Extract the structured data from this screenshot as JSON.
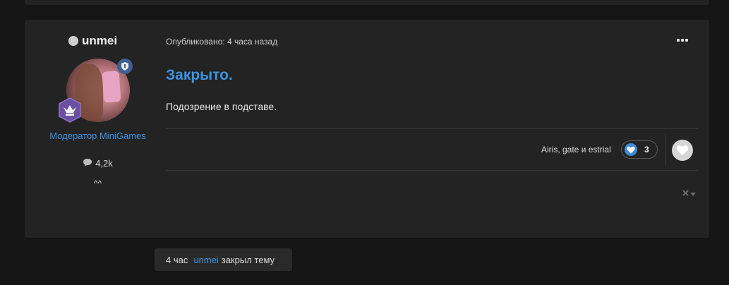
{
  "post": {
    "author": {
      "name": "unmei",
      "group": "Модератор MiniGames",
      "post_count": "4,2k",
      "signature": "^^"
    },
    "published": "Опубликовано: 4 часа назад",
    "title": "Закрыто.",
    "body": "Подозрение в подставе.",
    "reactions": {
      "names": "Airis, gate и estrial",
      "count": "3",
      "icon": "heart-icon",
      "color": "#3d8bd8"
    }
  },
  "event": {
    "time": "4 час",
    "user": "unmei",
    "action": "закрыл тему"
  },
  "colors": {
    "accent": "#3e93e0",
    "background": "#151515",
    "card": "#232323"
  }
}
